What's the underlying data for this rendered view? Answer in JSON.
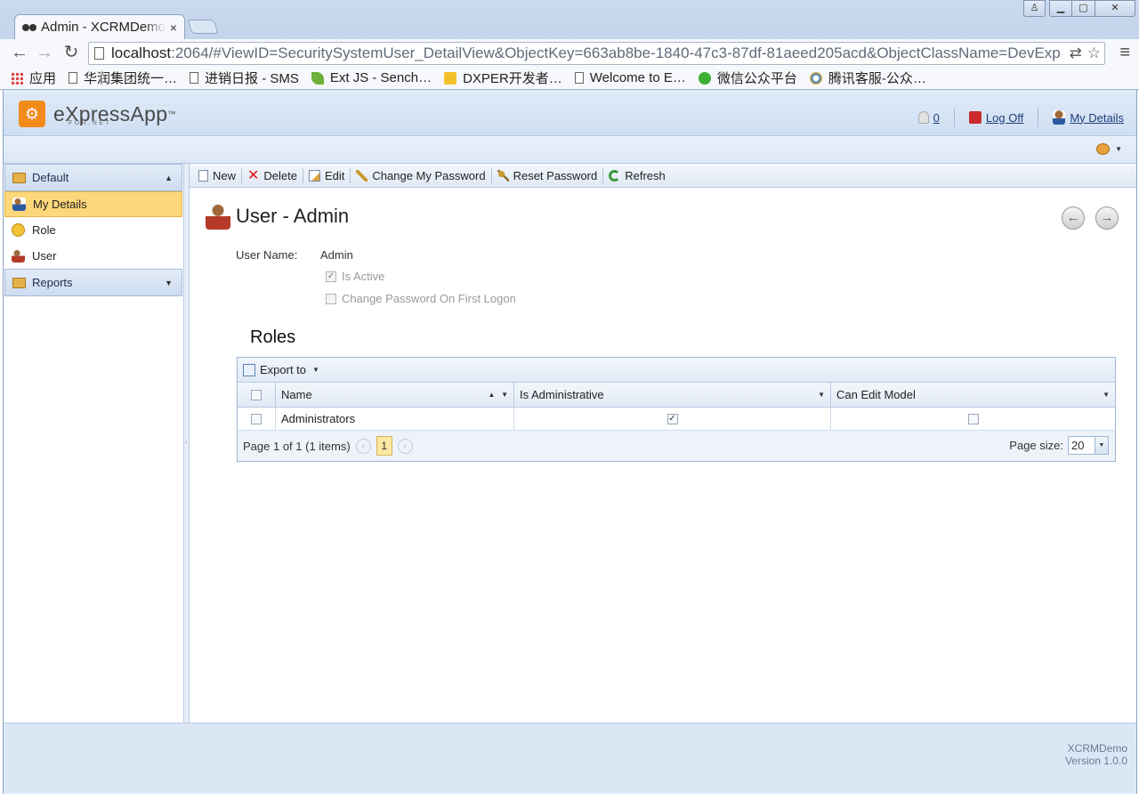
{
  "browser": {
    "tab_title": "Admin - XCRMDemo",
    "url_host": "localhost",
    "url_rest": ":2064/#ViewID=SecuritySystemUser_DetailView&ObjectKey=663ab8be-1840-47c3-87df-81aeed205acd&ObjectClassName=DevExp",
    "bookmarks": [
      "应用",
      "华润集团统一…",
      "进销日报 - SMS",
      "Ext JS - Sench…",
      "DXPER开发者…",
      "Welcome to E…",
      "微信公众平台",
      "腾讯客服-公众…"
    ]
  },
  "header": {
    "logo_text": "eXpressApp",
    "logo_tm": "™",
    "logo_sub": "FOR.NET",
    "notifications_count": "0",
    "logoff_label": "Log Off",
    "mydetails_label": "My Details"
  },
  "sidebar": {
    "groups": [
      {
        "label": "Default",
        "expanded": true
      },
      {
        "label": "Reports",
        "expanded": false
      }
    ],
    "items": [
      {
        "label": "My Details",
        "active": true
      },
      {
        "label": "Role",
        "active": false
      },
      {
        "label": "User",
        "active": false
      }
    ]
  },
  "actions": [
    "New",
    "Delete",
    "Edit",
    "Change My Password",
    "Reset Password",
    "Refresh"
  ],
  "view": {
    "title": "User - Admin",
    "user_name_label": "User Name:",
    "user_name_value": "Admin",
    "is_active_label": "Is Active",
    "is_active_checked": true,
    "change_pwd_label": "Change Password On First Logon",
    "change_pwd_checked": false
  },
  "roles": {
    "caption": "Roles",
    "export_label": "Export to",
    "columns": [
      "Name",
      "Is Administrative",
      "Can Edit Model"
    ],
    "rows": [
      {
        "name": "Administrators",
        "is_administrative": true,
        "can_edit_model": false
      }
    ],
    "pager_text": "Page 1 of 1 (1 items)",
    "current_page": "1",
    "page_size_label": "Page size:",
    "page_size": "20"
  },
  "footer": {
    "app_name": "XCRMDemo",
    "version": "Version 1.0.0"
  }
}
